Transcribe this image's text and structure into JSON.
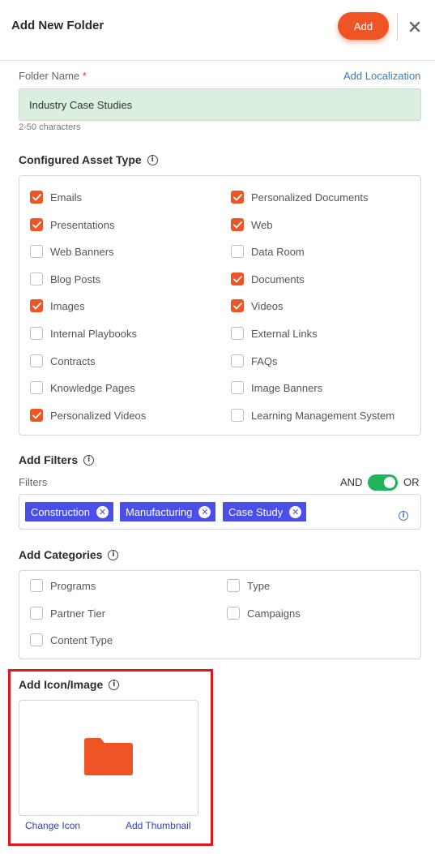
{
  "header": {
    "title": "Add New Folder",
    "add_label": "Add"
  },
  "folder_name": {
    "label": "Folder Name",
    "required_mark": "*",
    "localization_link": "Add Localization",
    "value": "Industry Case Studies",
    "hint": "2-50 characters"
  },
  "asset_types": {
    "title": "Configured Asset Type",
    "items": [
      {
        "label": "Emails",
        "checked": true
      },
      {
        "label": "Personalized Documents",
        "checked": true
      },
      {
        "label": "Presentations",
        "checked": true
      },
      {
        "label": "Web",
        "checked": true
      },
      {
        "label": "Web Banners",
        "checked": false
      },
      {
        "label": "Data Room",
        "checked": false
      },
      {
        "label": "Blog Posts",
        "checked": false
      },
      {
        "label": "Documents",
        "checked": true
      },
      {
        "label": "Images",
        "checked": true
      },
      {
        "label": "Videos",
        "checked": true
      },
      {
        "label": "Internal Playbooks",
        "checked": false
      },
      {
        "label": "External Links",
        "checked": false
      },
      {
        "label": "Contracts",
        "checked": false
      },
      {
        "label": "FAQs",
        "checked": false
      },
      {
        "label": "Knowledge Pages",
        "checked": false
      },
      {
        "label": "Image Banners",
        "checked": false
      },
      {
        "label": "Personalized Videos",
        "checked": true
      },
      {
        "label": "Learning Management System",
        "checked": false
      }
    ]
  },
  "filters": {
    "title": "Add Filters",
    "label": "Filters",
    "and_label": "AND",
    "or_label": "OR",
    "toggle_on": true,
    "chips": [
      {
        "label": "Construction"
      },
      {
        "label": "Manufacturing"
      },
      {
        "label": "Case Study"
      }
    ]
  },
  "categories": {
    "title": "Add Categories",
    "items": [
      {
        "label": "Programs",
        "checked": false
      },
      {
        "label": "Type",
        "checked": false
      },
      {
        "label": "Partner Tier",
        "checked": false
      },
      {
        "label": "Campaigns",
        "checked": false
      },
      {
        "label": "Content Type",
        "checked": false
      }
    ]
  },
  "icon_image": {
    "title": "Add Icon/Image",
    "icon": "folder-icon",
    "change_icon": "Change Icon",
    "add_thumbnail": "Add Thumbnail"
  },
  "colors": {
    "accent": "#ef5424",
    "chip": "#4a4fe8",
    "toggle": "#1fb35a",
    "input_bg": "#dcefdf",
    "highlight": "#e0151d"
  }
}
